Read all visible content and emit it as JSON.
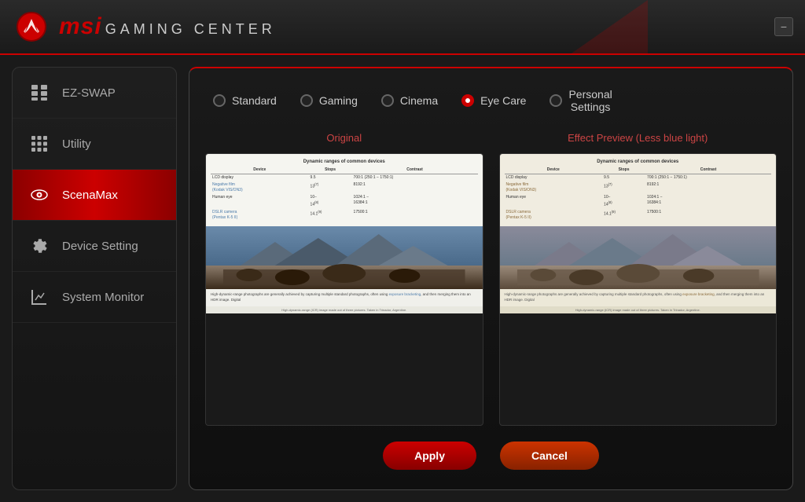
{
  "app": {
    "title": "MSI GAMING CENTER",
    "brand": "msi",
    "subtitle": "GAMING CENTER",
    "minimize_label": "−"
  },
  "sidebar": {
    "items": [
      {
        "id": "ez-swap",
        "label": "EZ-SWAP",
        "icon": "grid-icon",
        "active": false
      },
      {
        "id": "utility",
        "label": "Utility",
        "icon": "apps-icon",
        "active": false
      },
      {
        "id": "scenamax",
        "label": "ScenaMax",
        "icon": "eye-icon",
        "active": true
      },
      {
        "id": "device-setting",
        "label": "Device Setting",
        "icon": "gear-icon",
        "active": false
      },
      {
        "id": "system-monitor",
        "label": "System Monitor",
        "icon": "chart-icon",
        "active": false
      }
    ]
  },
  "main": {
    "options": [
      {
        "id": "standard",
        "label": "Standard",
        "active": false
      },
      {
        "id": "gaming",
        "label": "Gaming",
        "active": false
      },
      {
        "id": "cinema",
        "label": "Cinema",
        "active": false
      },
      {
        "id": "eye-care",
        "label": "Eye Care",
        "active": true
      },
      {
        "id": "personal-settings",
        "label": "Personal\nSettings",
        "active": false
      }
    ],
    "original_title": "Original",
    "preview_title": "Effect Preview (Less blue light)",
    "apply_label": "Apply",
    "cancel_label": "Cancel"
  },
  "image_content": {
    "table_title": "Dynamic ranges of common devices",
    "table_headers": [
      "Device",
      "Stops",
      "Contrast"
    ],
    "table_rows": [
      [
        "LCD display",
        "9.5",
        "700:1 (250:1 − 1750:1)"
      ],
      [
        "Negative film (Kodak VIS/ON3)",
        "13(7)",
        "8192:1"
      ],
      [
        "Human eye",
        "10− 14(8)",
        "1024:1 − 16384:1"
      ],
      [
        "DSLR camera (Pentax K-5 II)",
        "14.1(9)",
        "17500:1"
      ]
    ],
    "body_text": "High-dynamic-range photographs are generally achieved by capturing multiple standard photographs, often using exposure bracketing, and then merging them into an HDR image. Digital",
    "caption": "High-dynamic-range (ICR) image made out of three pictures. Taken in Trinador, Argentine."
  }
}
